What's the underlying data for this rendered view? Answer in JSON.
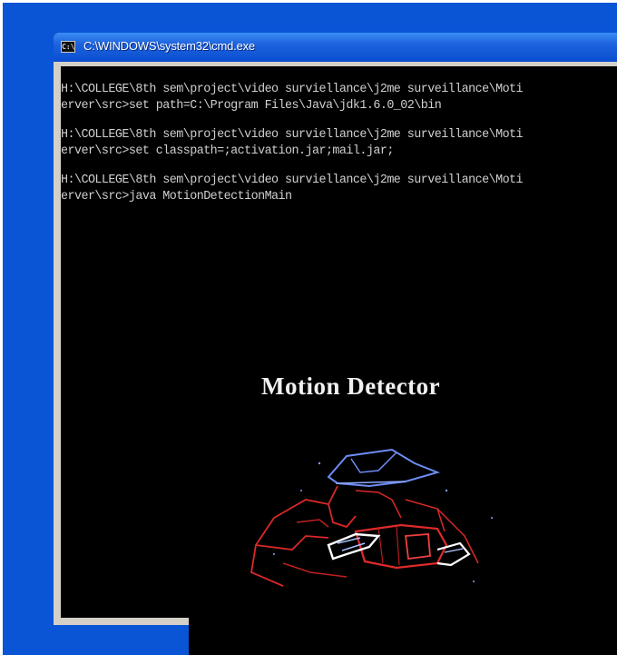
{
  "window": {
    "title": "C:\\WINDOWS\\system32\\cmd.exe",
    "icon": "console-icon",
    "icon_glyph": "C:\\"
  },
  "console": {
    "lines": [
      "H:\\COLLEGE\\8th sem\\project\\video surviellance\\j2me surveillance\\Moti",
      "erver\\src>set path=C:\\Program Files\\Java\\jdk1.6.0_02\\bin",
      "H:\\COLLEGE\\8th sem\\project\\video surviellance\\j2me surveillance\\Moti",
      "erver\\src>set classpath=;activation.jar;mail.jar;",
      "H:\\COLLEGE\\8th sem\\project\\video surviellance\\j2me surveillance\\Moti",
      "erver\\src>java MotionDetectionMain"
    ]
  },
  "splash": {
    "title": "Motion Detector",
    "image": "spy-with-camera-neon-illustration"
  },
  "colors": {
    "desktop": "#0a55d6",
    "titlebar": "#1d62dd",
    "console_bg": "#000000",
    "console_text": "#cfcfcf"
  }
}
